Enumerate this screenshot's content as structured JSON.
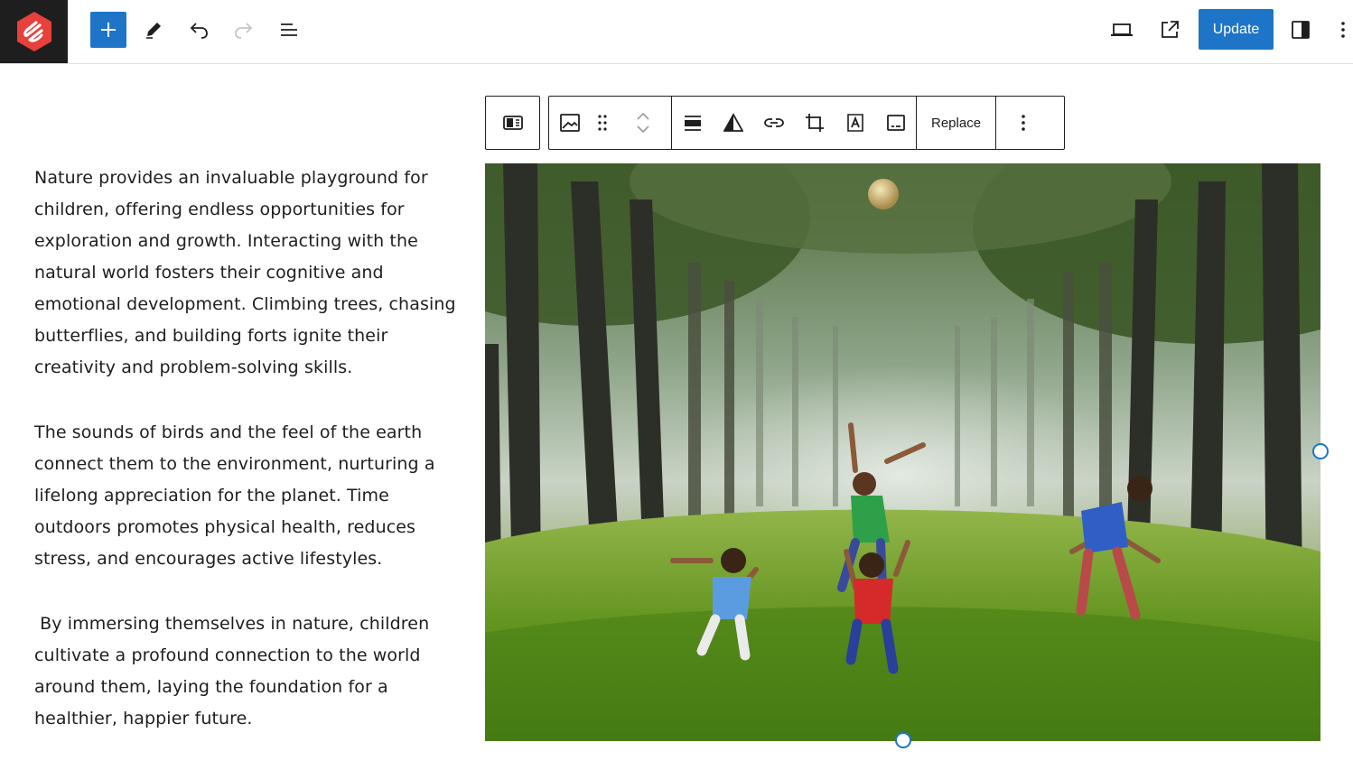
{
  "toolbar": {
    "update_label": "Update"
  },
  "block_toolbar": {
    "replace_label": "Replace"
  },
  "content": {
    "paragraphs": [
      "Nature provides an invaluable playground for children, offering endless opportunities for exploration and growth. Interacting with the natural world fosters their cognitive and emotional development. Climbing trees, chasing butterflies, and building forts ignite their creativity and problem-solving skills.",
      "The sounds of birds and the feel of the earth connect them to the environment, nurturing a lifelong appreciation for the planet. Time outdoors promotes physical health, reduces stress, and encourages active lifestyles.",
      " By immersing themselves in nature, children cultivate a profound connection to the world around them, laying the foundation for a healthier, happier future."
    ]
  },
  "colors": {
    "accent": "#1e75c8",
    "logo_red": "#e8403a",
    "logo_bg": "#1e1e1e"
  },
  "icons": [
    "site-logo-icon",
    "plus-icon",
    "pencil-icon",
    "undo-icon",
    "redo-icon",
    "list-view-icon",
    "desktop-preview-icon",
    "external-link-icon",
    "sidebar-toggle-icon",
    "kebab-menu-icon",
    "media-text-icon",
    "image-icon",
    "drag-handle-icon",
    "chevron-up-icon",
    "chevron-down-icon",
    "align-icon",
    "duotone-icon",
    "link-icon",
    "crop-icon",
    "text-overlay-icon",
    "caption-icon"
  ]
}
